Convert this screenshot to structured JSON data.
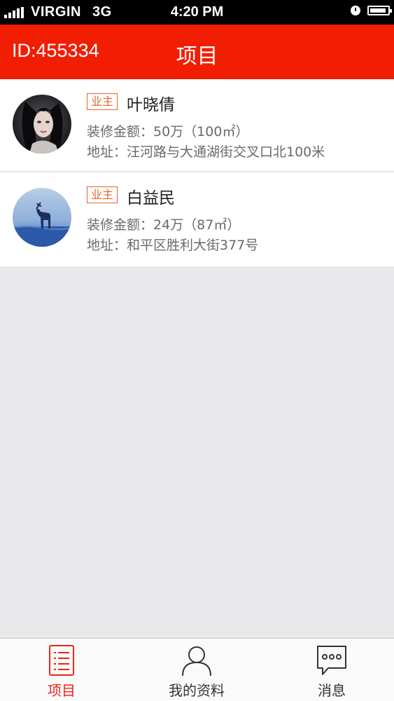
{
  "status_bar": {
    "carrier": "VIRGIN",
    "network": "3G",
    "time": "4:20 PM",
    "icons": [
      "signal-icon",
      "alarm-clock-icon",
      "battery-icon"
    ]
  },
  "header": {
    "user_id": "ID:455334",
    "title": "项目"
  },
  "projects": [
    {
      "tag": "业主",
      "name": "叶晓倩",
      "amount": "装修金额：50万（100㎡）",
      "address": "地址：汪河路与大通湖街交叉口北100米",
      "avatar": "woman-portrait"
    },
    {
      "tag": "业主",
      "name": "白益民",
      "amount": "装修金额：24万（87㎡）",
      "address": "地址：和平区胜利大街377号",
      "avatar": "deer-in-water"
    }
  ],
  "tab_bar": {
    "items": [
      {
        "label": "项目",
        "icon": "list-document-icon",
        "active": true
      },
      {
        "label": "我的资料",
        "icon": "person-icon",
        "active": false
      },
      {
        "label": "消息",
        "icon": "chat-bubble-icon",
        "active": false
      }
    ]
  },
  "colors": {
    "header_bg": "#f21e04",
    "tag_orange": "#e8642a",
    "active_tab": "#e8261a",
    "page_bg": "#e9e9eb"
  }
}
